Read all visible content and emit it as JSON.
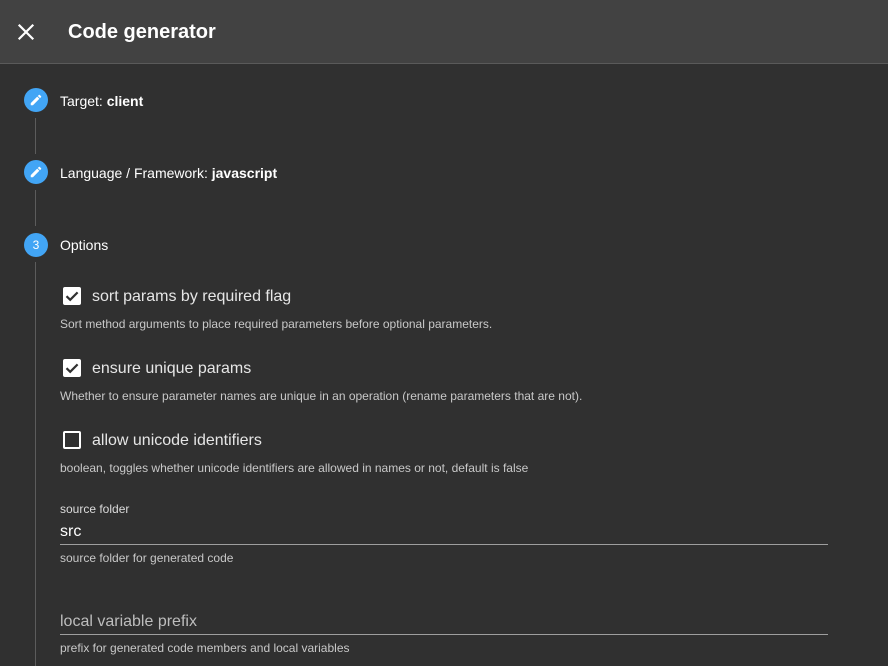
{
  "header": {
    "title": "Code generator",
    "close_icon": "close-icon"
  },
  "steps": [
    {
      "number": "1",
      "icon": "pencil-icon",
      "label": "Target:",
      "value": "client"
    },
    {
      "number": "2",
      "icon": "pencil-icon",
      "label": "Language / Framework:",
      "value": "javascript"
    },
    {
      "number": "3",
      "label": "Options"
    }
  ],
  "options": {
    "sort_params": {
      "label": "sort params by required flag",
      "hint": "Sort method arguments to place required parameters before optional parameters.",
      "checked": true
    },
    "ensure_unique": {
      "label": "ensure unique params",
      "hint": "Whether to ensure parameter names are unique in an operation (rename parameters that are not).",
      "checked": true
    },
    "allow_unicode": {
      "label": "allow unicode identifiers",
      "hint": "boolean, toggles whether unicode identifiers are allowed in names or not, default is false",
      "checked": false
    },
    "source_folder": {
      "label": "source folder",
      "value": "src",
      "hint": "source folder for generated code"
    },
    "local_var_prefix": {
      "placeholder": "local variable prefix",
      "value": "",
      "hint": "prefix for generated code members and local variables"
    }
  },
  "colors": {
    "background": "#303030",
    "header": "#424242",
    "accent": "#42a5f5"
  }
}
